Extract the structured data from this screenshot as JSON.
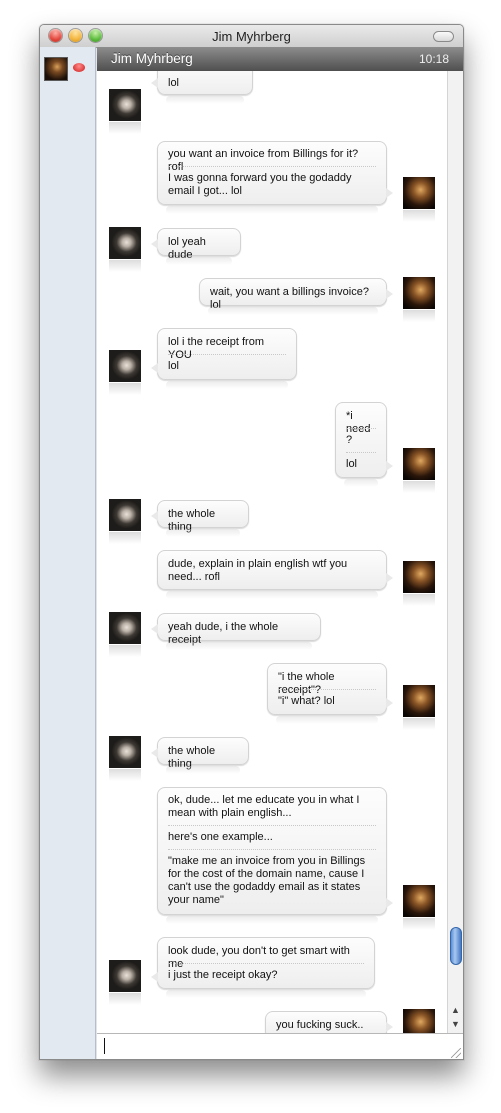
{
  "window": {
    "title": "Jim Myhrberg"
  },
  "header": {
    "name": "Jim Myhrberg",
    "time": "10:18"
  },
  "messages": [
    {
      "from": "contact",
      "lines": [
        "lol"
      ]
    },
    {
      "from": "me",
      "lines": [
        "you want an invoice from Billings for it? rofl",
        "I was gonna forward you the godaddy email I got... lol"
      ]
    },
    {
      "from": "contact",
      "lines": [
        "lol yeah dude"
      ]
    },
    {
      "from": "me",
      "lines": [
        "wait, you want a billings invoice? lol"
      ]
    },
    {
      "from": "contact",
      "lines": [
        "lol i the receipt from YOU",
        "lol"
      ]
    },
    {
      "from": "me",
      "lines": [
        "*i need",
        "?",
        "lol"
      ]
    },
    {
      "from": "contact",
      "lines": [
        "the whole thing"
      ]
    },
    {
      "from": "me",
      "lines": [
        "dude, explain in plain english wtf you need... rofl"
      ]
    },
    {
      "from": "contact",
      "lines": [
        "yeah dude, i the whole receipt"
      ]
    },
    {
      "from": "me",
      "lines": [
        "\"i the whole receipt\"?",
        "\"i\" what? lol"
      ]
    },
    {
      "from": "contact",
      "lines": [
        "the whole thing"
      ]
    },
    {
      "from": "me",
      "lines": [
        "ok, dude... let me educate you in what I mean with plain english...",
        "here's one example...",
        "\"make me an invoice from you in Billings for the cost of the domain name, cause I can't use the godaddy email as it states your name\""
      ]
    },
    {
      "from": "contact",
      "lines": [
        "look dude, you don't to get smart with me",
        "i just the receipt okay?"
      ]
    },
    {
      "from": "me",
      "lines": [
        "you fucking suck.. lol"
      ]
    }
  ]
}
